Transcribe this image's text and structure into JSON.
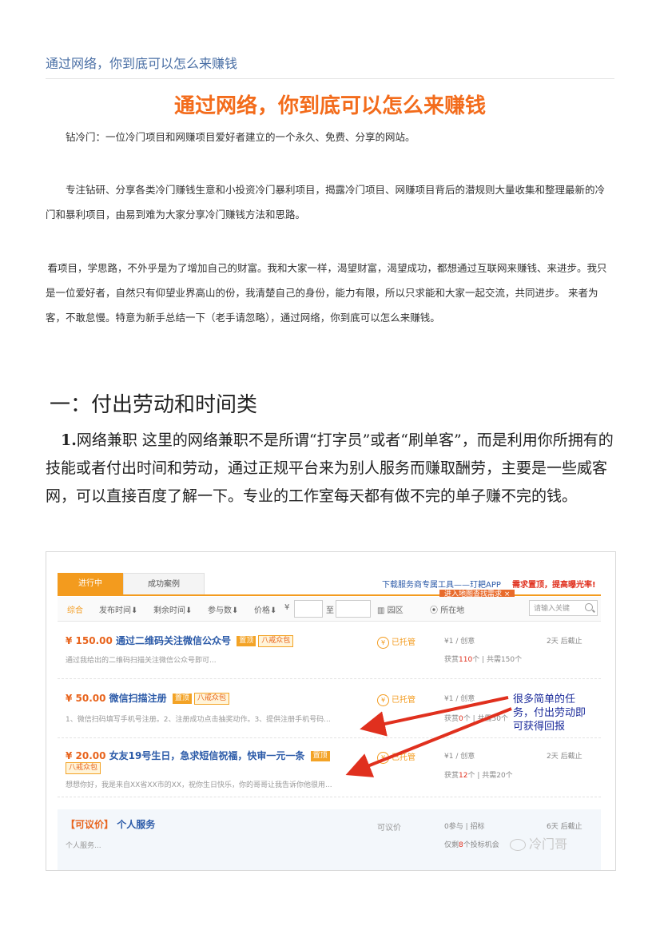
{
  "header": {
    "title": "通过网络，你到底可以怎么来赚钱"
  },
  "main_title": "通过网络，你到底可以怎么来赚钱",
  "paragraphs": [
    "钻冷门：一位冷门项目和网赚项目爱好者建立的一个永久、免费、分享的网站。",
    "专注钻研、分享各类冷门赚钱生意和小投资冷门暴利项目，揭露冷门项目、网赚项目背后的潜规则大量收集和整理最新的冷门和暴利项目，由易到难为大家分享冷门赚钱方法和思路。",
    "看项目，学思路，不外乎是为了增加自己的财富。我和大家一样，渴望财富，渴望成功，都想通过互联网来赚钱、来进步。我只是一位爱好者，自然只有仰望业界高山的份，我清楚自己的身份，能力有限，所以只求能和大家一起交流，共同进步。 来者为客，不敢怠慢。特意为新手总结一下（老手请忽略），通过网络，你到底可以怎么来赚钱。"
  ],
  "section": {
    "heading": "一：付出劳动和时间类",
    "lead_bold": "1.",
    "body": "网络兼职 这里的网络兼职不是所谓“打字员”或者“刷单客”，而是利用你所拥有的技能或者付出时间和劳动，通过正规平台来为别人服务而赚取酬劳，主要是一些威客网，可以直接百度了解一下。专业的工作室每天都有做不完的单子赚不完的钱。"
  },
  "screenshot": {
    "tabs": [
      "进行中",
      "成功案例"
    ],
    "promo_text": "下载服务商专属工具——玎耙APP",
    "promo_red": "需求置顶，提高曝光率!",
    "map_tag": "进入地图查找需求 ×",
    "filters": {
      "items": [
        "综合",
        "发布时间⬇",
        "剩余时间⬇",
        "参与数⬇",
        "价格⬇",
        "¥",
        "至",
        "园区",
        "所在地"
      ],
      "search_placeholder": "请输入关键"
    },
    "tasks": [
      {
        "price": "¥ 150.00",
        "title": "通过二维码关注微信公众号",
        "badges": [
          "置顶",
          "八戒众包"
        ],
        "desc": "通过我给出的二维码扫描关注微信公众号即可...",
        "status": "已托管",
        "reward": "¥1 / 创意",
        "stat_prefix": "获赏",
        "stat_count": "110",
        "stat_suffix": "个 | 共需150个",
        "deadline": "2天 后截止"
      },
      {
        "price": "¥ 50.00",
        "title": "微信扫描注册",
        "badges": [
          "置顶",
          "八戒众包"
        ],
        "desc": "1、微信扫码填写手机号注册。2、注册成功点击抽奖动作。3、提供注册手机号码...",
        "status": "已托管",
        "reward": "¥1 / 创意",
        "stat_prefix": "获赏",
        "stat_count": "0",
        "stat_suffix": "个 | 共需50个",
        "deadline": ""
      },
      {
        "price": "¥ 20.00",
        "title": "女友19号生日，急求短信祝福，快审一元一条",
        "badges": [
          "置顶",
          "八戒众包"
        ],
        "desc": "想想你好，我是来自XX省XX市的XX，祝你生日快乐，你的哥哥让我告诉你他很用...",
        "status": "已托管",
        "reward": "¥1 / 创意",
        "stat_prefix": "获赏",
        "stat_count": "12",
        "stat_suffix": "个 | 共需20个",
        "deadline": "2天 后截止"
      },
      {
        "price": "【可议价】",
        "title": "个人服务",
        "badges": [],
        "desc": "个人服务...",
        "status": "可议价",
        "reward": "0参与 | 招标",
        "stat_prefix": "仅剩",
        "stat_count": "8",
        "stat_suffix": "个投标机会",
        "deadline": "6天 后截止"
      }
    ],
    "annotation": [
      "很多简单的任",
      "务，付出劳动即",
      "可获得回报"
    ],
    "watermark": "冷门哥",
    "colors": {
      "accent": "#f39b1e",
      "price": "#e8641d",
      "link": "#2b5aa8",
      "arrow": "#e0301e"
    }
  }
}
